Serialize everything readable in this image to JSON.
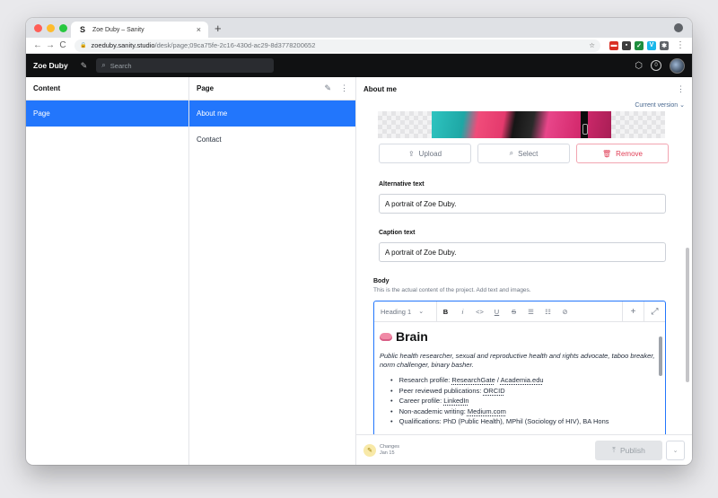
{
  "browser": {
    "tab_title": "Zoe Duby – Sanity",
    "tab_favicon": "S",
    "tab_close": "×",
    "new_tab": "+",
    "nav": {
      "back": "←",
      "forward": "→",
      "reload": "C"
    },
    "url_host": "zoeduby.sanity.studio",
    "url_path": "/desk/page;09ca75fe-2c16-430d-ac29-8d3778200652",
    "bookmark_icon": "☆",
    "extensions": [
      {
        "name": "ext-red",
        "color": "#d93025",
        "glyph": "▬"
      },
      {
        "name": "ext-dark",
        "color": "#3c3c3c",
        "glyph": "▪"
      },
      {
        "name": "ext-green",
        "color": "#1e8e3e",
        "glyph": "✓"
      },
      {
        "name": "ext-vimeo",
        "color": "#1ab7ea",
        "glyph": "V"
      },
      {
        "name": "ext-puzzle",
        "color": "#5f6368",
        "glyph": "✱"
      }
    ]
  },
  "studio": {
    "brand": "Zoe Duby",
    "compose_icon": "✎",
    "search_placeholder": "Search",
    "search_icon": "⌕",
    "package_icon": "⬡",
    "badge": "0"
  },
  "content_pane": {
    "title": "Content",
    "items": [
      {
        "label": "Page"
      }
    ]
  },
  "page_pane": {
    "title": "Page",
    "compose_icon": "✎",
    "menu_icon": "⋮",
    "items": [
      {
        "label": "About me"
      },
      {
        "label": "Contact"
      }
    ]
  },
  "document": {
    "title": "About me",
    "menu_icon": "⋮",
    "version": "Current version ⌄",
    "image_buttons": {
      "upload": "Upload",
      "select": "Select",
      "remove": "Remove"
    },
    "alt_label": "Alternative text",
    "alt_value": "A portrait of Zoe Duby.",
    "caption_label": "Caption text",
    "caption_value": "A portrait of Zoe Duby.",
    "body_label": "Body",
    "body_description": "This is the actual content of the project. Add text and images.",
    "toolbar": {
      "style": "Heading 1",
      "bold": "B",
      "italic": "i",
      "code": "<>",
      "underline": "U",
      "strike": "S",
      "bullet": "☰",
      "numbered": "☷",
      "link": "⊘",
      "add": "+",
      "expand": "⤢"
    },
    "body": {
      "heading": "Brain",
      "intro": "Public health researcher, sexual and reproductive health and rights advocate, taboo breaker, norm challenger, binary basher.",
      "items": [
        {
          "prefix": "Research profile: ",
          "link1": "ResearchGate",
          "sep": " / ",
          "link2": "Academia.edu"
        },
        {
          "prefix": "Peer reviewed publications: ",
          "link1": "ORCID",
          "sep": "",
          "link2": ""
        },
        {
          "prefix": "Career profile: ",
          "link1": "LinkedIn",
          "sep": "",
          "link2": ""
        },
        {
          "prefix": "Non-academic writing: ",
          "link1": "Medium.com",
          "sep": "",
          "link2": ""
        },
        {
          "prefix": "Qualifications: PhD (Public Health), MPhil (Sociology of HIV), BA Hons",
          "link1": "",
          "sep": "",
          "link2": ""
        }
      ]
    },
    "footer": {
      "changes_label": "Changes",
      "changes_date": "Jan 15",
      "publish": "Publish",
      "publish_menu": "⌄"
    }
  }
}
